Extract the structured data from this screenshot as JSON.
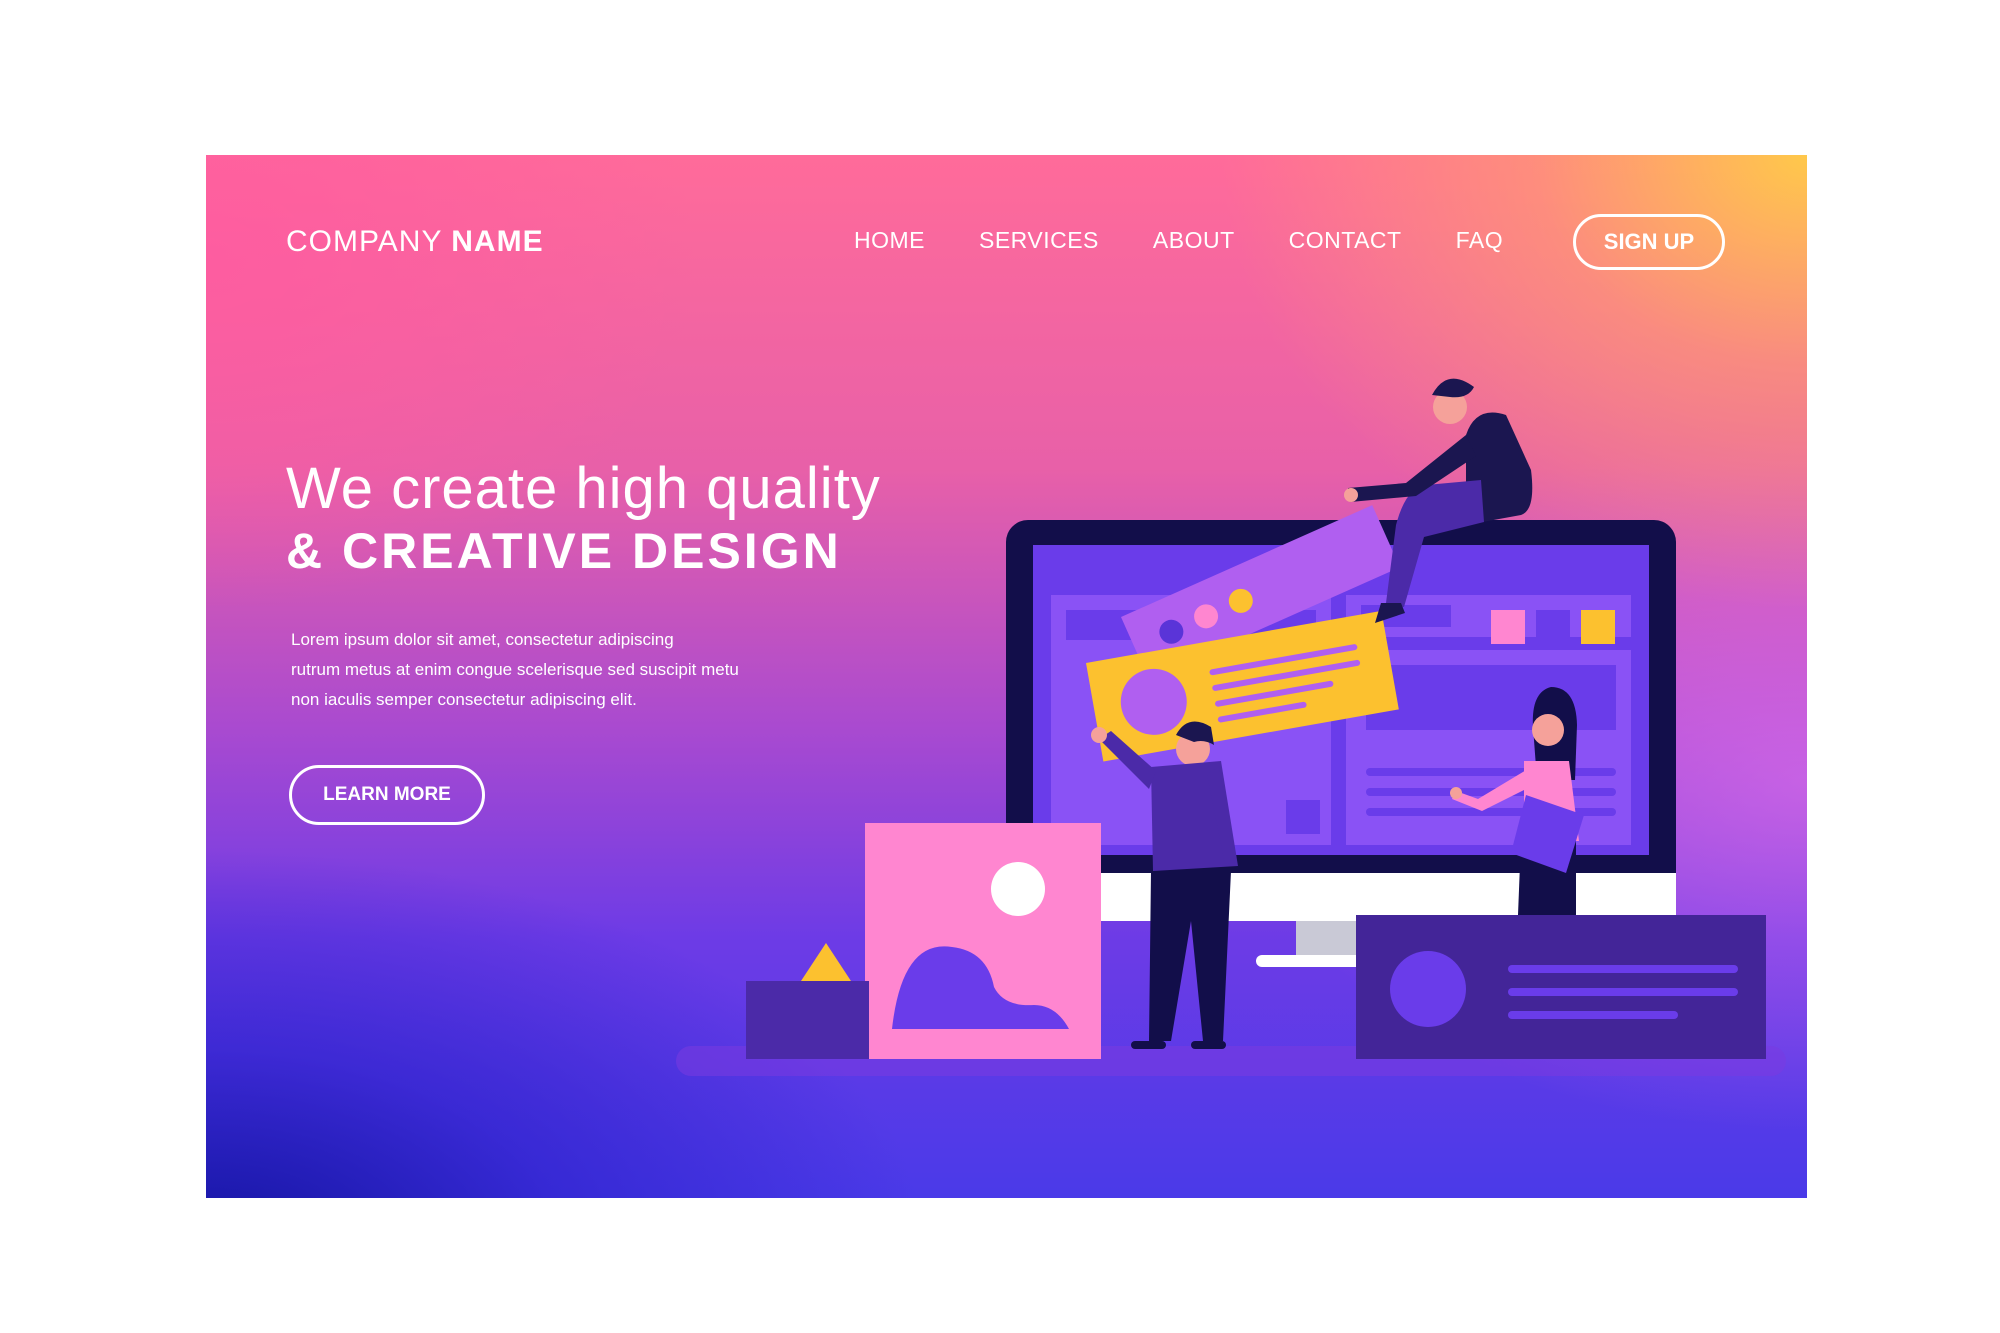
{
  "brand": {
    "company_light": "COMPANY",
    "company_bold": "NAME"
  },
  "nav": {
    "items": [
      "HOME",
      "SERVICES",
      "ABOUT",
      "CONTACT",
      "FAQ"
    ],
    "signup_label": "SIGN UP"
  },
  "hero": {
    "headline_line1": "We create high quality",
    "headline_line2": "& CREATIVE DESIGN",
    "body_lines": [
      "Lorem ipsum dolor sit amet, consectetur adipiscing",
      "rutrum metus at enim congue scelerisque sed suscipit metu",
      "non iaculis semper consectetur adipiscing elit."
    ],
    "cta_label": "LEARN MORE"
  },
  "illustration": {
    "name": "web-design-team-illustration",
    "colors": {
      "monitor_frame": "#120e4a",
      "screen": "#6a3cea",
      "card_yellow": "#fcc12f",
      "card_purple": "#b05ff0",
      "card_pink": "#ff86d0",
      "dark_card": "#432598"
    }
  }
}
